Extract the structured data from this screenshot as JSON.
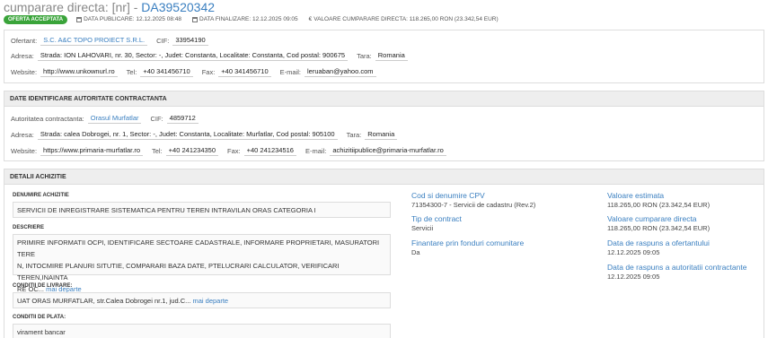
{
  "header": {
    "title_prefix": "cumparare directa: [nr] - ",
    "title_code": "DA39520342",
    "badge": "OFERTA ACCEPTATA",
    "data_publicare": "DATA PUBLICARE: 12.12.2025 08:48",
    "data_finalizare": "DATA FINALIZARE: 12.12.2025 09:05",
    "valoare": "VALOARE CUMPARARE DIRECTA: 118.265,00  RON (23.342,54  EUR)"
  },
  "ofertant": {
    "label": "Ofertant:",
    "name": "S.C. A&C TOPO PROIECT S.R.L.",
    "cif_label": "CIF:",
    "cif": "33954190",
    "adresa_label": "Adresa:",
    "adresa": "Strada: ION LAHOVARI, nr. 30, Sector: -, Judet: Constanta, Localitate: Constanta, Cod postal: 900675",
    "tara_label": "Tara:",
    "tara": "Romania",
    "website_label": "Website:",
    "website": "http://www.unkownurl.ro",
    "tel_label": "Tel:",
    "tel": "+40 341456710",
    "fax_label": "Fax:",
    "fax": "+40 341456710",
    "email_label": "E-mail:",
    "email": "leruaban@yahoo.com"
  },
  "autoritate": {
    "heading": "DATE IDENTIFICARE AUTORITATE CONTRACTANTA",
    "label": "Autoritatea contractanta:",
    "name": "Orasul Murfatlar",
    "cif_label": "CIF:",
    "cif": "4859712",
    "adresa_label": "Adresa:",
    "adresa": "Strada: calea Dobrogei, nr. 1, Sector: -, Judet: Constanta, Localitate: Murfatlar, Cod postal: 905100",
    "tara_label": "Tara:",
    "tara": "Romania",
    "website_label": "Website:",
    "website": "https://www.primaria-murfatlar.ro",
    "tel_label": "Tel:",
    "tel": "+40 241234350",
    "fax_label": "Fax:",
    "fax": "+40 241234516",
    "email_label": "E-mail:",
    "email": "achizitiipublice@primaria-murfatlar.ro"
  },
  "detalii": {
    "heading": "DETALII ACHIZITIE",
    "denumire_label": "DENUMIRE ACHIZITIE",
    "denumire": "SERVICII DE INREGISTRARE SISTEMATICA PENTRU TEREN INTRAVILAN ORAS CATEGORIA I",
    "descriere_label": "DESCRIERE",
    "descriere_1": "PRIMIRE INFORMATII OCPI, IDENTIFICARE SECTOARE CADASTRALE, INFORMARE PROPRIETARI, MASURATORI TERE",
    "descriere_2": "N, INTOCMIRE PLANURI SITUTIE, COMPARARI BAZA DATE, PTELUCRARI CALCULATOR, VERIFICARI TEREN,INAINTA",
    "descriere_3": "RE OC...",
    "mai_departe": "mai departe",
    "livrare_label": "CONDITII DE LIVRARE:",
    "livrare": "UAT ORAS MURFATLAR, str.Calea Dobrogei nr.1, jud.C...",
    "plata_label": "CONDITII DE PLATA:",
    "plata": "virament bancar",
    "cpv_label": "Cod si denumire CPV",
    "cpv": "71354300-7 - Servicii de cadastru (Rev.2)",
    "tip_label": "Tip de contract",
    "tip": "Servicii",
    "finantare_label": "Finantare prin fonduri comunitare",
    "finantare": "Da",
    "val_estimata_label": "Valoare estimata",
    "val_estimata": "118.265,00  RON (23.342,54  EUR)",
    "val_cumparare_label": "Valoare cumparare directa",
    "val_cumparare": "118.265,00  RON (23.342,54  EUR)",
    "raspuns_ofertant_label": "Data de raspuns a ofertantului",
    "raspuns_ofertant": "12.12.2025 09:05",
    "raspuns_autoritate_label": "Data de raspuns a autoritatii contractante",
    "raspuns_autoritate": "12.12.2025 09:05"
  }
}
